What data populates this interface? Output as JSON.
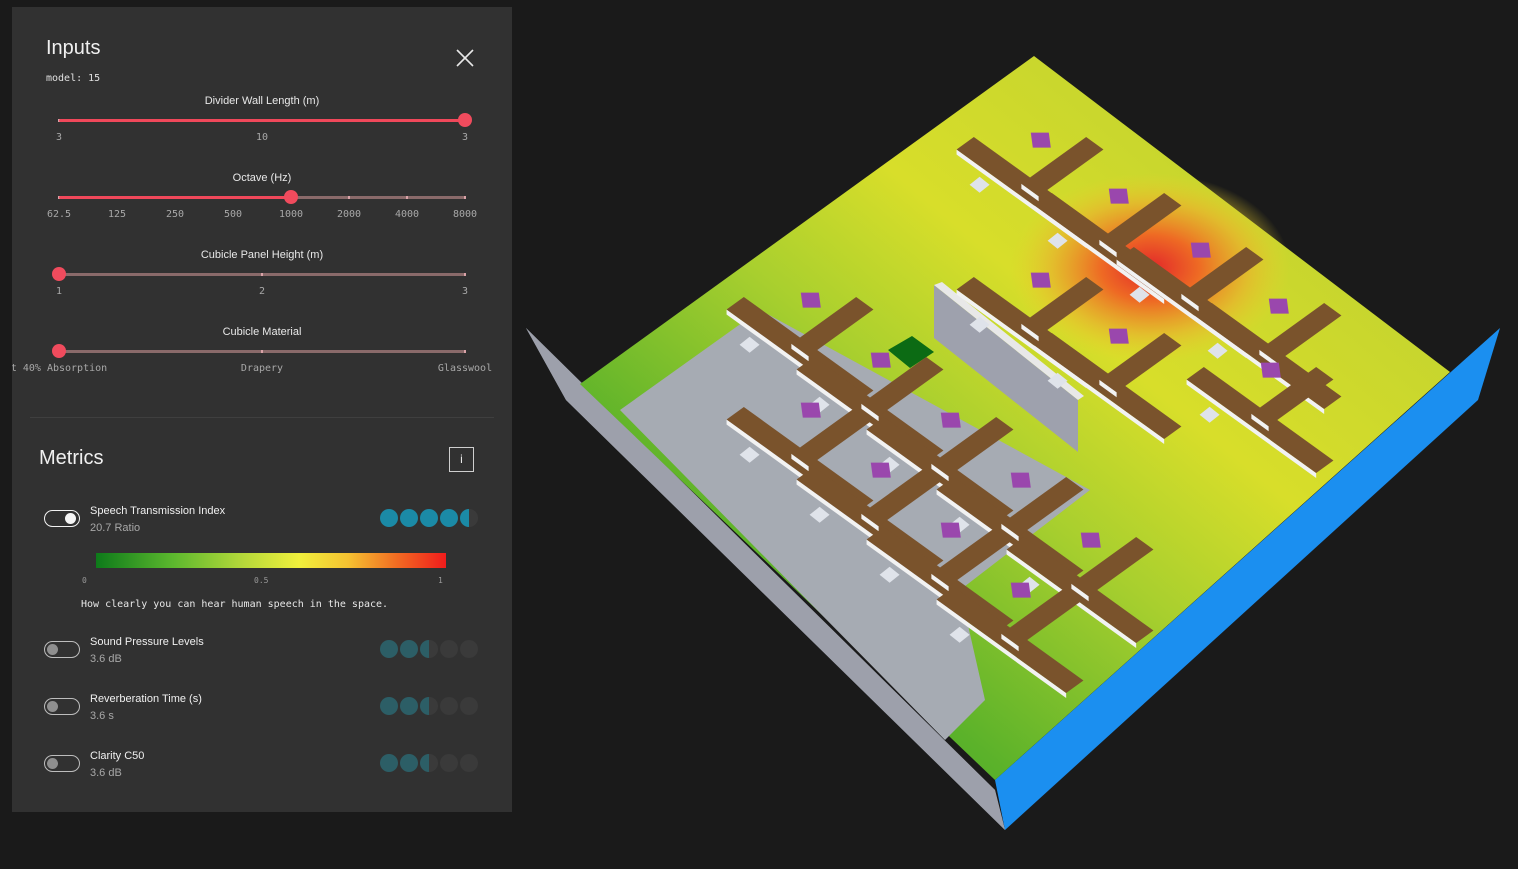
{
  "inputs": {
    "title": "Inputs",
    "model_label": "model: 15",
    "sliders": [
      {
        "label": "Divider Wall Length (m)",
        "ticks": [
          "3",
          "10",
          "3"
        ],
        "value_fraction": 1.0
      },
      {
        "label": "Octave (Hz)",
        "ticks": [
          "62.5",
          "125",
          "250",
          "500",
          "1000",
          "2000",
          "4000",
          "8000"
        ],
        "value_fraction": 0.5714
      },
      {
        "label": "Cubicle Panel Height (m)",
        "ticks": [
          "1",
          "2",
          "3"
        ],
        "value_fraction": 0.0
      },
      {
        "label": "Cubicle Material",
        "ticks": [
          "t 40% Absorption",
          "Drapery",
          "Glasswool"
        ],
        "value_fraction": 0.0
      }
    ]
  },
  "metrics": {
    "title": "Metrics",
    "info_label": "i",
    "items": [
      {
        "name": "Speech Transmission Index",
        "value": "20.7 Ratio",
        "enabled": true,
        "rating": 4.5
      },
      {
        "name": "Sound Pressure Levels",
        "value": "3.6 dB",
        "enabled": false,
        "rating": 2.5
      },
      {
        "name": "Reverberation Time (s)",
        "value": "3.6 s",
        "enabled": false,
        "rating": 2.5
      },
      {
        "name": "Clarity C50",
        "value": "3.6 dB",
        "enabled": false,
        "rating": 2.5
      }
    ],
    "legend": {
      "min": "0",
      "mid": "0.5",
      "max": "1"
    },
    "description": "How clearly you can hear human speech in the space."
  },
  "colors": {
    "accent": "#f04b5d",
    "rating_active": "#1b8aa6",
    "rating_inactive": "#2c5e66",
    "rating_empty": "#3a3a3a",
    "floor_side": "#8a8d99",
    "wall_blue": "#1b8ff0",
    "desk": "#7a532c",
    "monitor": "#9a47ad"
  },
  "icons": {
    "close": "close-icon",
    "toggle": "toggle-switch"
  }
}
